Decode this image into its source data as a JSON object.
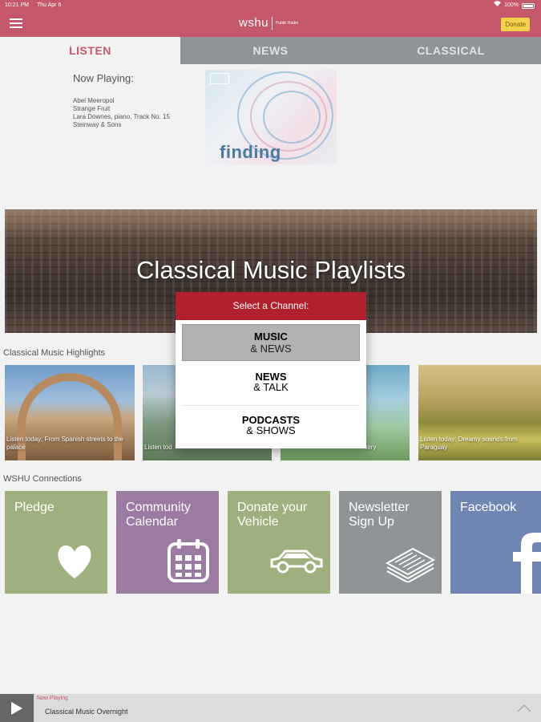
{
  "status_bar": {
    "time": "10:21 PM",
    "date": "Thu Apr 6",
    "battery": "100%"
  },
  "header": {
    "logo": "wshu",
    "logo_sub": "Public Radio",
    "donate_label": "Donate"
  },
  "tabs": [
    {
      "label": "LISTEN",
      "active": true
    },
    {
      "label": "NEWS",
      "active": false
    },
    {
      "label": "CLASSICAL",
      "active": false
    }
  ],
  "now_playing": {
    "label": "Now Playing:",
    "lines": [
      "Abel Meeropol",
      "Strange Fruit",
      "Lara Downes, piano, Track No. 15",
      "Steinway & Sons"
    ],
    "album_word": "finding"
  },
  "hero": {
    "title": "Classical Music Playlists"
  },
  "highlights": {
    "label": "Classical Music Highlights",
    "cards": [
      {
        "caption": "Listen today: From Spanish streets to the palace"
      },
      {
        "caption": "Listen tod"
      },
      {
        "caption": "tery"
      },
      {
        "caption": "Listen today: Dreamy sounds from Paraguay"
      }
    ]
  },
  "channel_modal": {
    "title": "Select a Channel:",
    "channels": [
      {
        "line1": "MUSIC",
        "line2": "& NEWS",
        "selected": true
      },
      {
        "line1": "NEWS",
        "line2": "& TALK",
        "selected": false
      },
      {
        "line1": "PODCASTS",
        "line2": "& SHOWS",
        "selected": false
      }
    ]
  },
  "connections": {
    "label": "WSHU Connections",
    "tiles": [
      {
        "label": "Pledge",
        "icon": "heart-icon"
      },
      {
        "label": "Community Calendar",
        "icon": "calendar-icon"
      },
      {
        "label": "Donate your Vehicle",
        "icon": "car-icon"
      },
      {
        "label": "Newsletter Sign Up",
        "icon": "newspaper-icon"
      },
      {
        "label": "Facebook",
        "icon": "facebook-icon"
      }
    ]
  },
  "player": {
    "label": "Now Playing",
    "title": "Classical Music Overnight"
  },
  "colors": {
    "brand": "#c4586a",
    "tab_bar": "#8f9497",
    "modal_head": "#b3202d",
    "donate": "#f2d24a"
  }
}
